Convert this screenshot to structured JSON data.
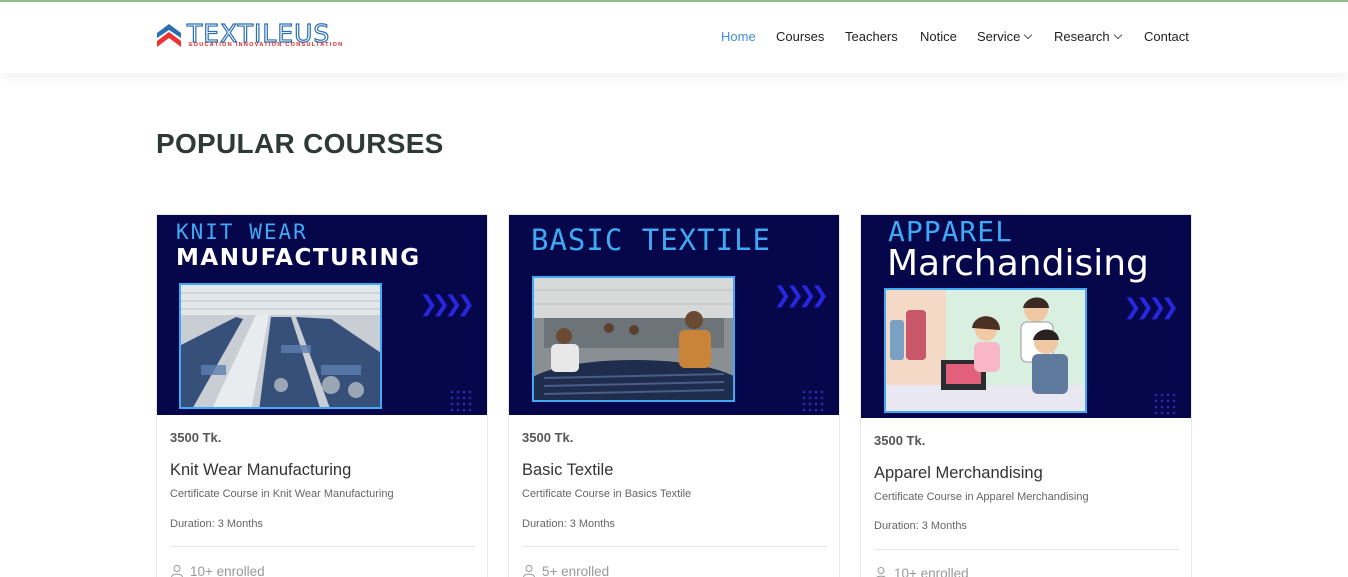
{
  "brand": {
    "name": "TEXTILEUS",
    "tagline": "EDUCATION INNOVATION CONSULTATION",
    "accent_color": "#2b6fb3",
    "tagline_color": "#dd2222"
  },
  "nav": {
    "items": [
      {
        "label": "Home",
        "active": true,
        "dropdown": false
      },
      {
        "label": "Courses",
        "active": false,
        "dropdown": false
      },
      {
        "label": "Teachers",
        "active": false,
        "dropdown": false
      },
      {
        "label": "Notice",
        "active": false,
        "dropdown": false
      },
      {
        "label": "Service",
        "active": false,
        "dropdown": true
      },
      {
        "label": "Research",
        "active": false,
        "dropdown": true
      },
      {
        "label": "Contact",
        "active": false,
        "dropdown": false
      }
    ],
    "active_color": "#3f8fd6"
  },
  "section": {
    "title": "POPULAR COURSES"
  },
  "courses": [
    {
      "banner_line1": "KNIT WEAR",
      "banner_line2": "MANUFACTURING",
      "price": "3500 Tk.",
      "title": "Knit Wear Manufacturing",
      "subtitle": "Certificate Course in Knit Wear Manufacturing",
      "duration": "Duration: 3 Months",
      "enrolled": "10+ enrolled"
    },
    {
      "banner_line1": "BASIC TEXTILE",
      "price": "3500 Tk.",
      "title": "Basic Textile",
      "subtitle": "Certificate Course in Basics Textile",
      "duration": "Duration: 3 Months",
      "enrolled": "5+ enrolled"
    },
    {
      "banner_line1": "APPAREL",
      "banner_line2": "Marchandising",
      "price": "3500 Tk.",
      "title": "Apparel Merchandising",
      "subtitle": "Certificate Course in Apparel Merchandising",
      "duration": "Duration: 3 Months",
      "enrolled": "10+ enrolled"
    }
  ],
  "icons": {
    "banner_arrows": "double-chevron-right-icon",
    "enrolled": "user-icon"
  },
  "colors": {
    "banner_bg": "#06064a",
    "banner_title": "#3fa9f5",
    "heading": "#2f3a36"
  }
}
